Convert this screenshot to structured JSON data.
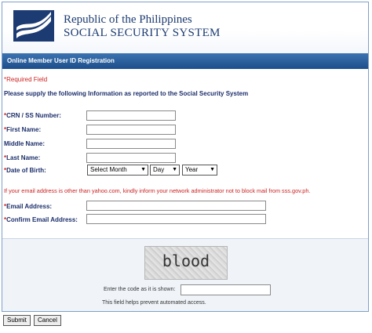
{
  "header": {
    "line1": "Republic of the Philippines",
    "line2": "SOCIAL SECURITY SYSTEM",
    "logo_icon": "sss-logo-icon"
  },
  "banner": {
    "title": "Online Member User ID Registration"
  },
  "notes": {
    "required": "*Required Field",
    "instructions": "Please supply the following Information as reported to the Social Security System",
    "email_note": "If your email address is other than yahoo.com, kindly inform your network administrator not to block mail from sss.gov.ph."
  },
  "form": {
    "crn_label": "CRN / SS Number:",
    "first_name_label": "First Name:",
    "middle_name_label": "Middle Name:",
    "last_name_label": "Last Name:",
    "dob_label": "Date of Birth:",
    "month_select": "Select Month",
    "day_select": "Day",
    "year_select": "Year",
    "email_label": "Email Address:",
    "confirm_email_label": "Confirm Email Address:",
    "required_mark": "*"
  },
  "captcha": {
    "word": "blood",
    "prompt": "Enter the code as it is shown:",
    "help": "This field helps prevent automated access."
  },
  "buttons": {
    "submit": "Submit",
    "cancel": "Cancel"
  },
  "colors": {
    "brand_blue": "#1c3b72",
    "required_red": "#cc2222",
    "banner": "#2a5f9e"
  }
}
